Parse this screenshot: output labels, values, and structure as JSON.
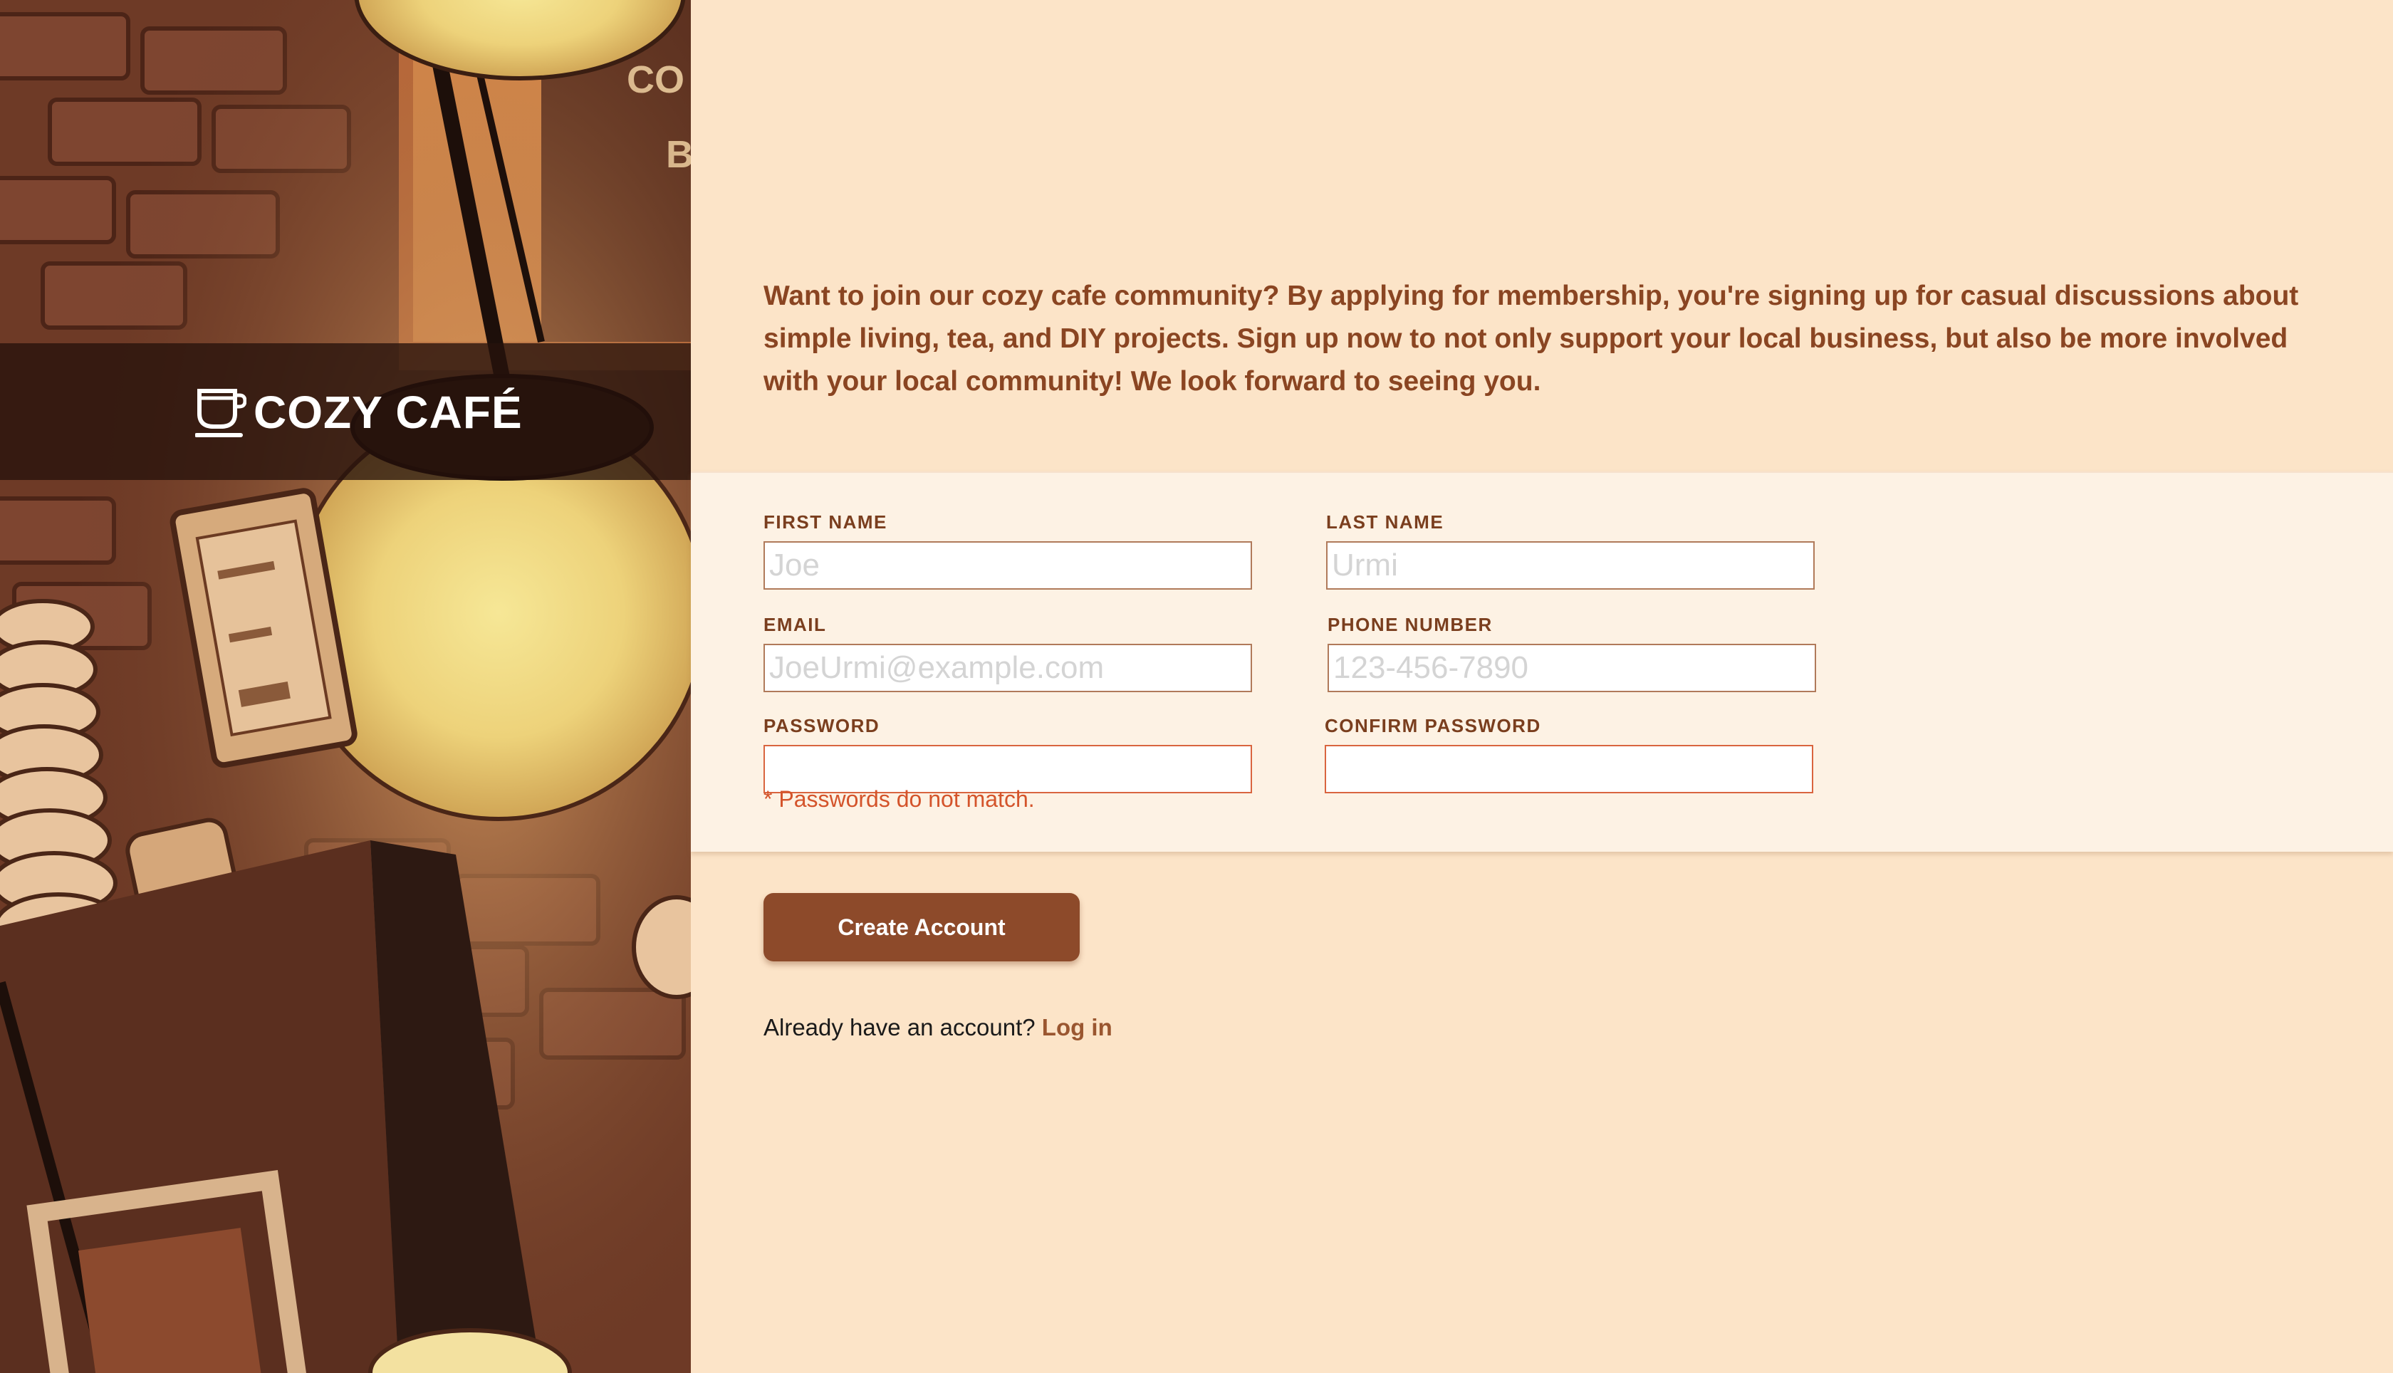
{
  "brand": {
    "name": "COZY CAFÉ",
    "icon": "coffee-cup-icon"
  },
  "intro": {
    "text": "Want to join our cozy cafe community? By applying for membership, you're signing up for casual discussions about simple living, tea, and DIY projects. Sign up now to not only support your local business, but also be more involved with your local community! We look forward to seeing you."
  },
  "form": {
    "first_name": {
      "label": "FIRST NAME",
      "placeholder": "Joe",
      "value": ""
    },
    "last_name": {
      "label": "LAST NAME",
      "placeholder": "Urmi",
      "value": ""
    },
    "email": {
      "label": "EMAIL",
      "placeholder": "JoeUrmi@example.com",
      "value": ""
    },
    "phone": {
      "label": "PHONE NUMBER",
      "placeholder": "123-456-7890",
      "value": ""
    },
    "password": {
      "label": "PASSWORD",
      "value": ""
    },
    "confirm_password": {
      "label": "CONFIRM PASSWORD",
      "value": ""
    },
    "error": "* Passwords do not match.",
    "submit_label": "Create Account"
  },
  "login": {
    "prompt": "Already have an account?",
    "link_label": "Log in"
  },
  "colors": {
    "background": "#fce4c8",
    "form_band": "#fdf2e4",
    "accent": "#8d4a2a",
    "heading_text": "#8a4522",
    "error": "#d4542b"
  }
}
